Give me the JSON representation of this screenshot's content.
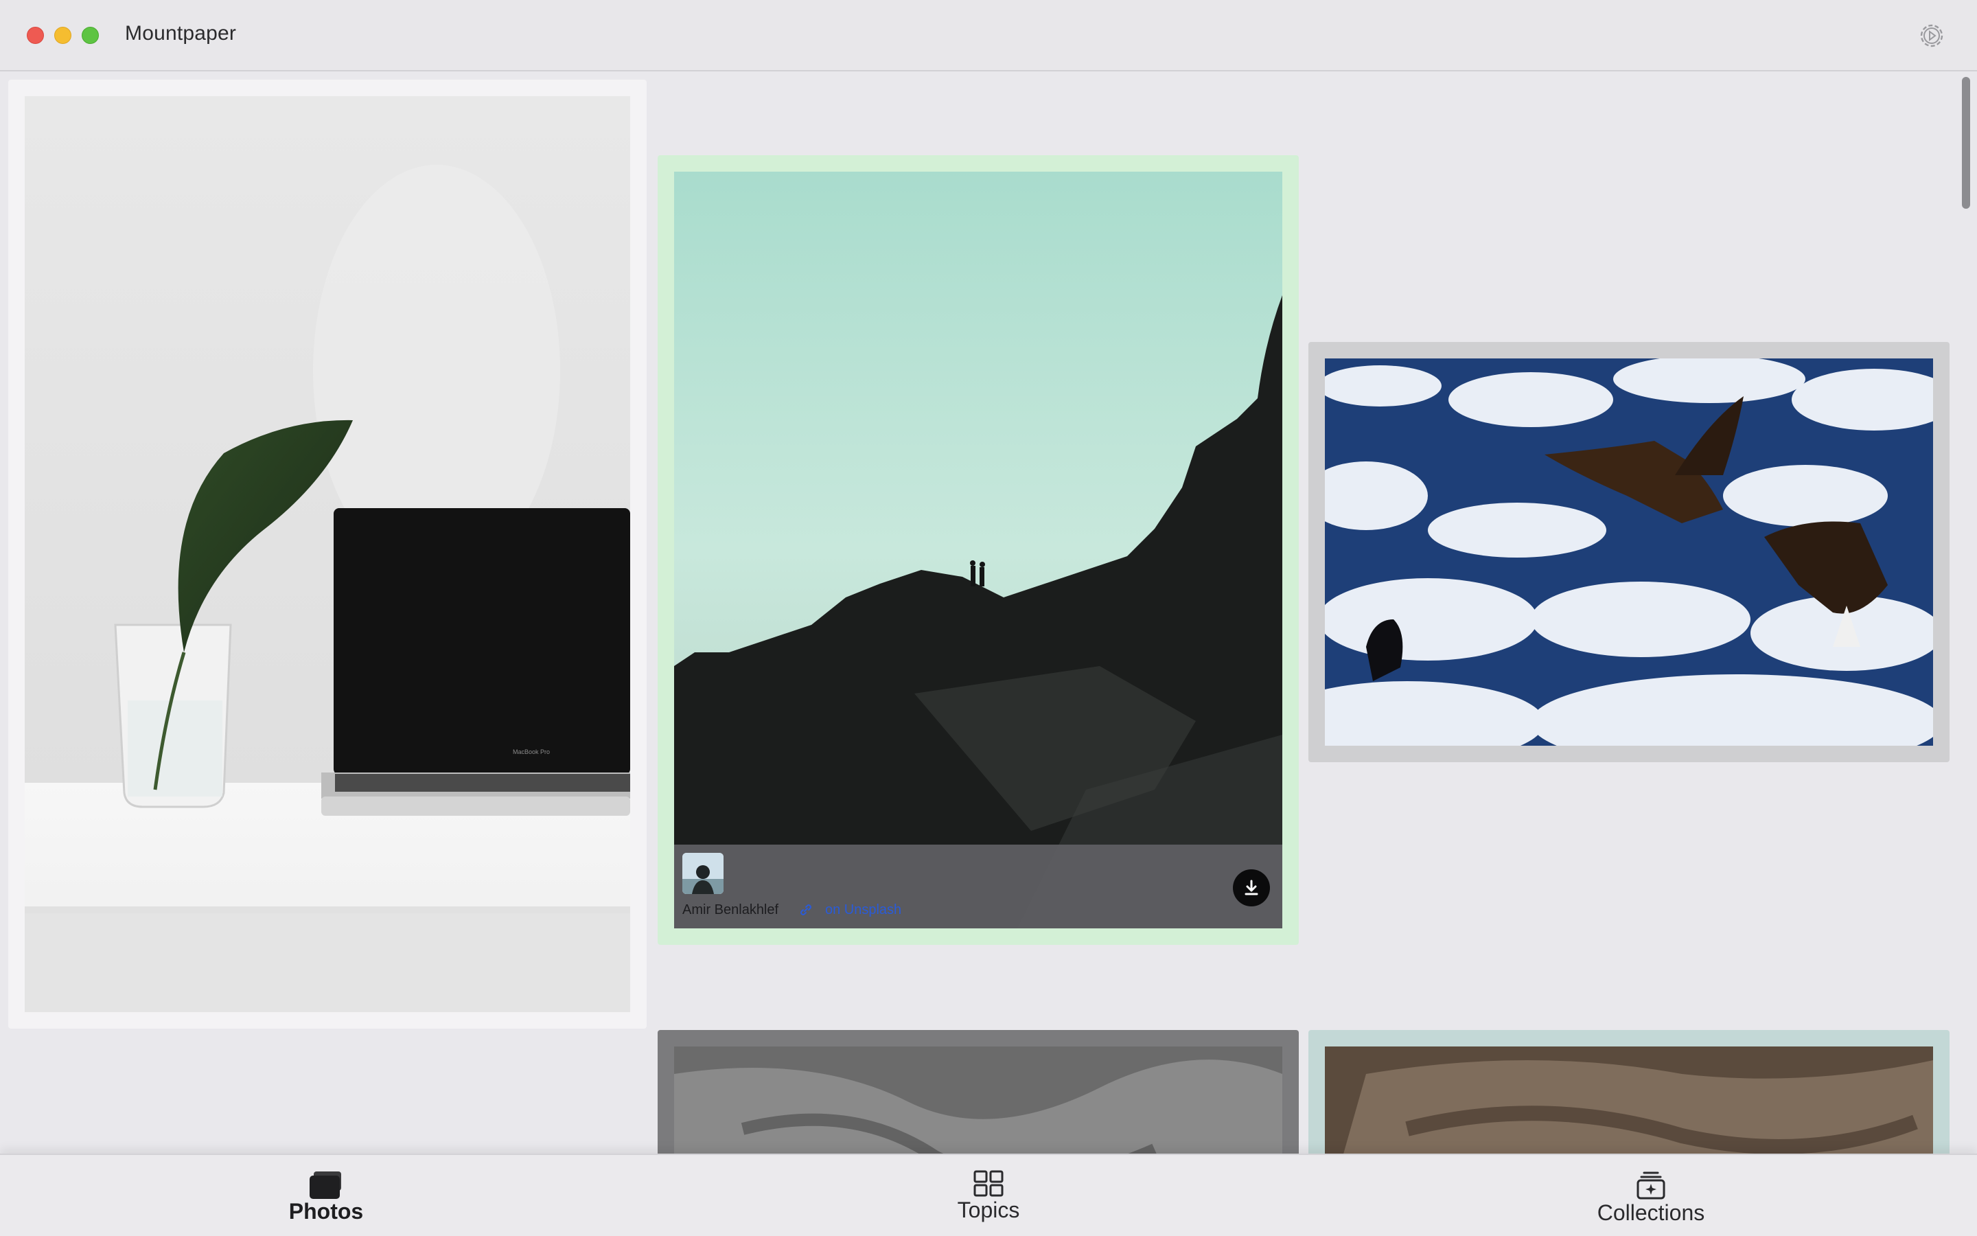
{
  "window": {
    "title": "Mountpaper",
    "settings_icon": "gear-icon"
  },
  "photos": [
    {
      "subject": "plant-and-laptop",
      "border_color": "#f4f3f5"
    },
    {
      "subject": "foggy-cliff-hikers",
      "border_color": "#d3f0d6",
      "overlay": {
        "author": "Amir Benlakhlef",
        "source": "on Unsplash",
        "link_icon": "link-icon",
        "download_icon": "download-icon"
      }
    },
    {
      "subject": "eagles-on-ice",
      "border_color": "#cfcfd1"
    },
    {
      "subject": "grey-fabric",
      "border_color": "#7b7b7d"
    },
    {
      "subject": "brown-fabric",
      "border_color": "#c3d8d6"
    }
  ],
  "tabs": [
    {
      "label": "Photos",
      "icon": "photos-icon",
      "selected": true
    },
    {
      "label": "Topics",
      "icon": "grid-icon",
      "selected": false
    },
    {
      "label": "Collections",
      "icon": "collections-icon",
      "selected": false
    }
  ]
}
